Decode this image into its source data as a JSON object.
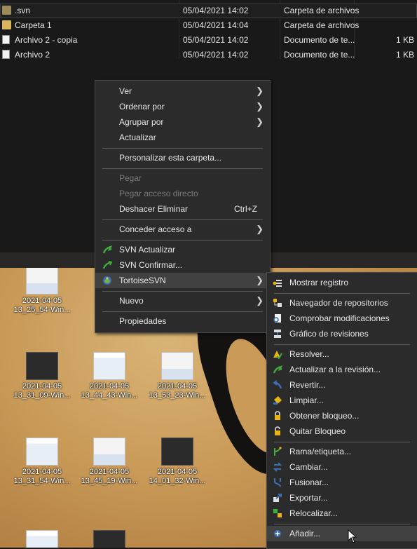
{
  "explorer": {
    "files": [
      {
        "name": ".svn",
        "date": "05/04/2021 14:02",
        "type": "Carpeta de archivos",
        "size": "",
        "icon": "folder-icon"
      },
      {
        "name": "Carpeta 1",
        "date": "05/04/2021 14:04",
        "type": "Carpeta de archivos",
        "size": "",
        "icon": "folder-icon"
      },
      {
        "name": "Archivo 2 - copia",
        "date": "05/04/2021 14:02",
        "type": "Documento de te...",
        "size": "1 KB",
        "icon": "document-icon"
      },
      {
        "name": "Archivo 2",
        "date": "05/04/2021 14:02",
        "type": "Documento de te...",
        "size": "1 KB",
        "icon": "document-icon"
      }
    ]
  },
  "desktop": {
    "icons": [
      {
        "line1": "2021-04-05",
        "line2": "13_25_54-Win..."
      },
      {
        "line1": "2021-04-05",
        "line2": "13_31_09-Win..."
      },
      {
        "line1": "2021-04-05",
        "line2": "13_44_43-Win..."
      },
      {
        "line1": "2021-04-05",
        "line2": "13_53_23-Win..."
      },
      {
        "line1": "2021-04-05",
        "line2": "13_31_54-Win..."
      },
      {
        "line1": "2021-04-05",
        "line2": "13_45_19-Win..."
      },
      {
        "line1": "2021-04-05",
        "line2": "14_01_32-Win..."
      }
    ]
  },
  "context_menu": {
    "items": [
      {
        "label": "Ver",
        "submenu": true
      },
      {
        "label": "Ordenar por",
        "submenu": true
      },
      {
        "label": "Agrupar por",
        "submenu": true
      },
      {
        "label": "Actualizar"
      },
      {
        "label": "Personalizar esta carpeta..."
      },
      {
        "label": "Pegar",
        "disabled": true
      },
      {
        "label": "Pegar acceso directo",
        "disabled": true
      },
      {
        "label": "Deshacer Eliminar",
        "shortcut": "Ctrl+Z"
      },
      {
        "label": "Conceder acceso a",
        "submenu": true
      },
      {
        "label": "SVN Actualizar",
        "icon": "svn-update-icon"
      },
      {
        "label": "SVN Confirmar...",
        "icon": "svn-commit-icon"
      },
      {
        "label": "TortoiseSVN",
        "icon": "tortoisesvn-icon",
        "submenu": true,
        "highlighted": true
      },
      {
        "label": "Nuevo",
        "submenu": true
      },
      {
        "label": "Propiedades"
      }
    ]
  },
  "tortoise_menu": {
    "items": [
      {
        "label": "Mostrar registro",
        "icon": "show-log-icon"
      },
      {
        "label": "Navegador de repositorios",
        "icon": "repo-browser-icon"
      },
      {
        "label": "Comprobar modificaciones",
        "icon": "check-modifications-icon"
      },
      {
        "label": "Gráfico de revisiones",
        "icon": "revision-graph-icon"
      },
      {
        "label": "Resolver...",
        "icon": "resolve-icon"
      },
      {
        "label": "Actualizar a la revisión...",
        "icon": "update-to-revision-icon"
      },
      {
        "label": "Revertir...",
        "icon": "revert-icon"
      },
      {
        "label": "Limpiar...",
        "icon": "cleanup-icon"
      },
      {
        "label": "Obtener bloqueo...",
        "icon": "get-lock-icon"
      },
      {
        "label": "Quitar Bloqueo",
        "icon": "release-lock-icon"
      },
      {
        "label": "Rama/etiqueta...",
        "icon": "branch-tag-icon"
      },
      {
        "label": "Cambiar...",
        "icon": "switch-icon"
      },
      {
        "label": "Fusionar...",
        "icon": "merge-icon"
      },
      {
        "label": "Exportar...",
        "icon": "export-icon"
      },
      {
        "label": "Relocalizar...",
        "icon": "relocate-icon"
      },
      {
        "label": "Añadir...",
        "icon": "add-icon",
        "highlighted": true
      }
    ]
  },
  "colors": {
    "menu_bg": "#2b2b2b",
    "menu_hover": "#414141",
    "svn_green": "#3fae3a"
  }
}
